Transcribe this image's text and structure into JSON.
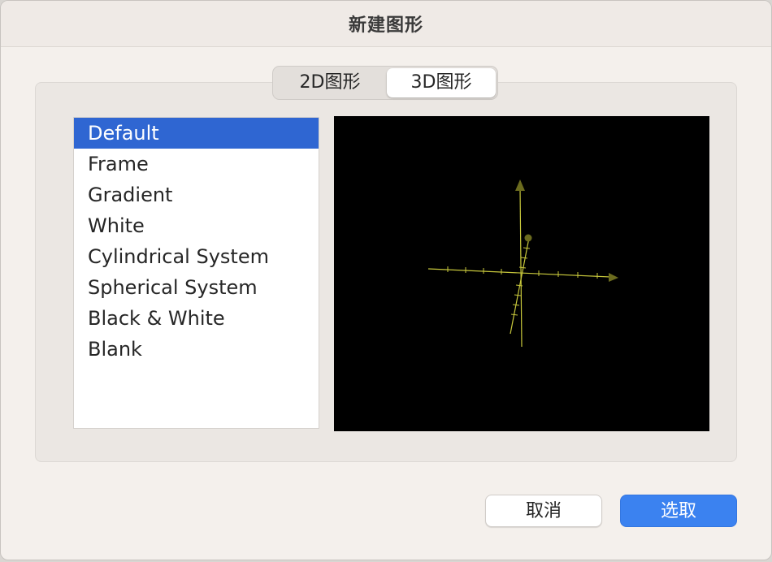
{
  "window": {
    "title": "新建图形"
  },
  "tabs": [
    {
      "label": "2D图形",
      "selected": false
    },
    {
      "label": "3D图形",
      "selected": true
    }
  ],
  "list": {
    "items": [
      {
        "label": "Default",
        "selected": true
      },
      {
        "label": "Frame",
        "selected": false
      },
      {
        "label": "Gradient",
        "selected": false
      },
      {
        "label": "White",
        "selected": false
      },
      {
        "label": "Cylindrical System",
        "selected": false
      },
      {
        "label": "Spherical System",
        "selected": false
      },
      {
        "label": "Black & White",
        "selected": false
      },
      {
        "label": "Blank",
        "selected": false
      }
    ]
  },
  "preview": {
    "background": "#000000",
    "axis_color": "#c8c83c",
    "arrow_color": "#6b6b1e"
  },
  "buttons": {
    "cancel_label": "取消",
    "ok_label": "选取"
  },
  "colors": {
    "accent": "#3b82f0",
    "selection": "#2f66d2"
  }
}
